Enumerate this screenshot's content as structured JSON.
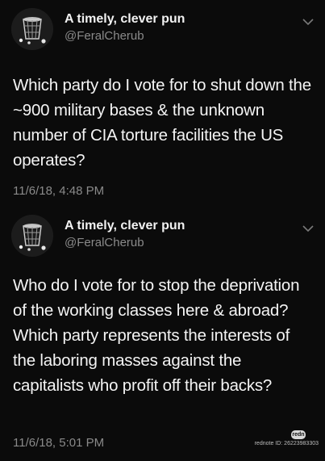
{
  "tweets": [
    {
      "display_name": "A timely, clever pun",
      "handle": "@FeralCherub",
      "body": "Which party do I vote for to shut down the ~900 military bases & the unknown number of CIA torture facilities the US operates?",
      "timestamp": "11/6/18, 4:48 PM",
      "avatar_icon": "trash-can-icon",
      "menu_icon": "chevron-down-icon"
    },
    {
      "display_name": "A timely, clever pun",
      "handle": "@FeralCherub",
      "body": "Who do I vote for to stop the deprivation of the working classes here & abroad? Which party represents the interests of the laboring masses against the capitalists who profit off their backs?",
      "timestamp": "11/6/18, 5:01 PM",
      "avatar_icon": "trash-can-icon",
      "menu_icon": "chevron-down-icon"
    }
  ],
  "watermark": {
    "badge": "redn",
    "text": "rednote ID: 26223983303"
  },
  "colors": {
    "background": "#0b0b0b",
    "text_primary": "#f4f4f4",
    "text_secondary": "#8a8a8a"
  }
}
